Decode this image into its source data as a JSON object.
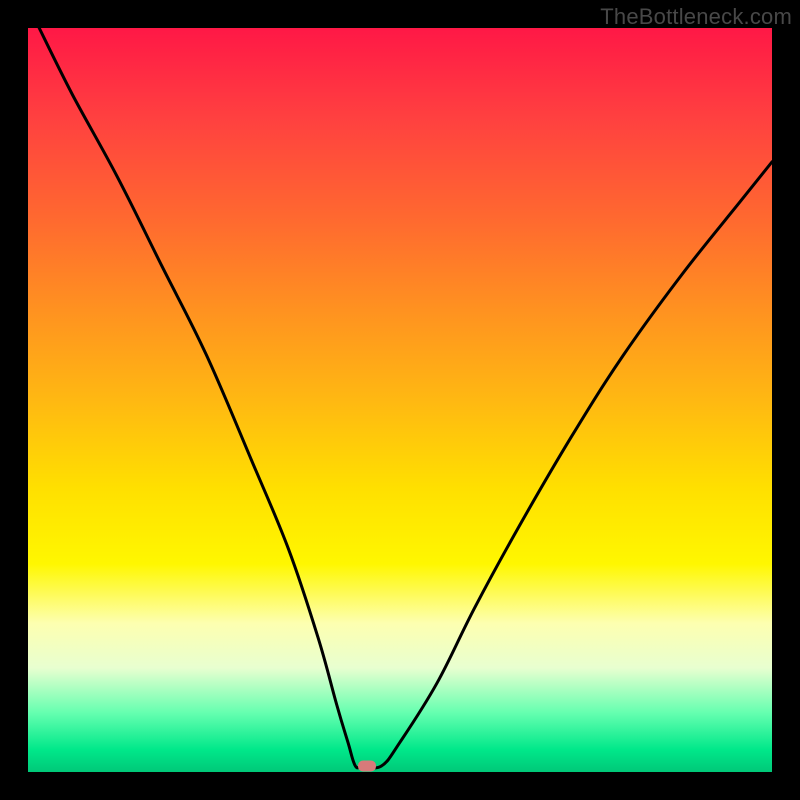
{
  "watermark": "TheBottleneck.com",
  "chart_data": {
    "type": "line",
    "title": "",
    "xlabel": "",
    "ylabel": "",
    "xlim": [
      0,
      100
    ],
    "ylim": [
      0,
      100
    ],
    "series": [
      {
        "name": "bottleneck-curve",
        "x": [
          1.5,
          6,
          12,
          18,
          24,
          30,
          35,
          39,
          41.5,
          43,
          44,
          45,
          47.5,
          50,
          55,
          60,
          66,
          73,
          80,
          88,
          96,
          100
        ],
        "y": [
          100,
          91,
          80,
          68,
          56,
          42,
          30,
          18,
          9,
          4,
          0.8,
          0.8,
          0.8,
          4,
          12,
          22,
          33,
          45,
          56,
          67,
          77,
          82
        ]
      }
    ],
    "marker": {
      "x": 45.5,
      "y": 0.8
    },
    "gradient_stops": [
      {
        "pct": 0,
        "color": "#ff1846"
      },
      {
        "pct": 50,
        "color": "#ffe000"
      },
      {
        "pct": 80,
        "color": "#fdffb0"
      },
      {
        "pct": 97,
        "color": "#00e88a"
      },
      {
        "pct": 100,
        "color": "#00c878"
      }
    ]
  }
}
